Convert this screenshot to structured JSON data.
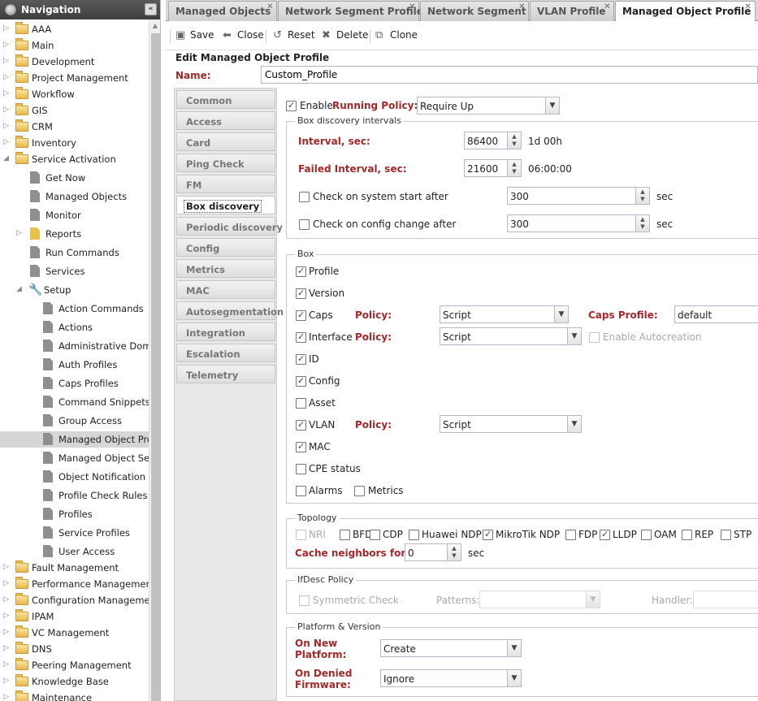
{
  "nav": {
    "title": "Navigation",
    "tree": [
      {
        "label": "AAA",
        "icon": "folder-icon",
        "expanded": false
      },
      {
        "label": "Main",
        "icon": "folder-icon",
        "expanded": false
      },
      {
        "label": "Development",
        "icon": "folder-icon",
        "expanded": false
      },
      {
        "label": "Project Management",
        "icon": "folder-icon",
        "expanded": false
      },
      {
        "label": "Workflow",
        "icon": "folder-icon",
        "expanded": false
      },
      {
        "label": "GIS",
        "icon": "folder-icon",
        "expanded": false
      },
      {
        "label": "CRM",
        "icon": "folder-icon",
        "expanded": false
      },
      {
        "label": "Inventory",
        "icon": "folder-icon",
        "expanded": false
      },
      {
        "label": "Service Activation",
        "icon": "folder-icon",
        "expanded": true
      },
      {
        "label": "Get Now",
        "icon": "document-icon"
      },
      {
        "label": "Managed Objects",
        "icon": "document-icon"
      },
      {
        "label": "Monitor",
        "icon": "document-icon"
      },
      {
        "label": "Reports",
        "icon": "report-icon",
        "expanded": false
      },
      {
        "label": "Run Commands",
        "icon": "document-icon"
      },
      {
        "label": "Services",
        "icon": "document-icon"
      },
      {
        "label": "Setup",
        "icon": "wrench-icon",
        "expanded": true
      },
      {
        "label": "Action Commands",
        "icon": "document-icon"
      },
      {
        "label": "Actions",
        "icon": "document-icon"
      },
      {
        "label": "Administrative Domains",
        "icon": "document-icon"
      },
      {
        "label": "Auth Profiles",
        "icon": "document-icon"
      },
      {
        "label": "Caps Profiles",
        "icon": "document-icon"
      },
      {
        "label": "Command Snippets",
        "icon": "document-icon"
      },
      {
        "label": "Group Access",
        "icon": "document-icon"
      },
      {
        "label": "Managed Object Profile",
        "icon": "document-icon",
        "selected": true
      },
      {
        "label": "Managed Object Selector",
        "icon": "document-icon"
      },
      {
        "label": "Object Notification",
        "icon": "document-icon"
      },
      {
        "label": "Profile Check Rules",
        "icon": "document-icon"
      },
      {
        "label": "Profiles",
        "icon": "document-icon"
      },
      {
        "label": "Service Profiles",
        "icon": "document-icon"
      },
      {
        "label": "User Access",
        "icon": "document-icon"
      },
      {
        "label": "Fault Management",
        "icon": "folder-icon",
        "expanded": false
      },
      {
        "label": "Performance Management",
        "icon": "folder-icon",
        "expanded": false
      },
      {
        "label": "Configuration Management",
        "icon": "folder-icon",
        "expanded": false
      },
      {
        "label": "IPAM",
        "icon": "folder-icon",
        "expanded": false
      },
      {
        "label": "VC Management",
        "icon": "folder-icon",
        "expanded": false
      },
      {
        "label": "DNS",
        "icon": "folder-icon",
        "expanded": false
      },
      {
        "label": "Peering Management",
        "icon": "folder-icon",
        "expanded": false
      },
      {
        "label": "Knowledge Base",
        "icon": "folder-icon",
        "expanded": false
      },
      {
        "label": "Maintenance",
        "icon": "folder-icon",
        "expanded": false
      }
    ]
  },
  "tabs": [
    {
      "label": "Managed Objects",
      "active": false
    },
    {
      "label": "Network Segment Profile",
      "active": false
    },
    {
      "label": "Network Segment",
      "active": false
    },
    {
      "label": "VLAN Profile",
      "active": false
    },
    {
      "label": "Managed Object Profile",
      "active": true
    }
  ],
  "toolbar": {
    "save": "Save",
    "close": "Close",
    "reset": "Reset",
    "delete": "Delete",
    "clone": "Clone"
  },
  "form": {
    "title": "Edit Managed Object Profile",
    "name_label": "Name:",
    "name_value": "Custom_Profile"
  },
  "side_tabs": [
    {
      "label": "Common"
    },
    {
      "label": "Access"
    },
    {
      "label": "Card"
    },
    {
      "label": "Ping Check"
    },
    {
      "label": "FM"
    },
    {
      "label": "Box discovery",
      "active": true
    },
    {
      "label": "Periodic discovery"
    },
    {
      "label": "Config"
    },
    {
      "label": "Metrics"
    },
    {
      "label": "MAC"
    },
    {
      "label": "Autosegmentation"
    },
    {
      "label": "Integration"
    },
    {
      "label": "Escalation"
    },
    {
      "label": "Telemetry"
    }
  ],
  "box_discovery": {
    "enable_label": "Enable",
    "running_policy_label": "Running Policy:",
    "running_policy_value": "Require Up",
    "intervals": {
      "legend": "Box discovery intervals",
      "interval_label": "Interval, sec:",
      "interval_value": "86400",
      "interval_hint": "1d 00h",
      "failed_label": "Failed Interval, sec:",
      "failed_value": "21600",
      "failed_hint": "06:00:00",
      "on_start_label": "Check on system start after",
      "on_start_value": "300",
      "on_start_unit": "sec",
      "on_change_label": "Check on config change after",
      "on_change_value": "300",
      "on_change_unit": "sec"
    },
    "box": {
      "legend": "Box",
      "profile": "Profile",
      "version": "Version",
      "caps": "Caps",
      "caps_policy_label": "Policy:",
      "caps_policy_value": "Script",
      "caps_profile_label": "Caps Profile:",
      "caps_profile_value": "default",
      "interface": "Interface",
      "interface_policy_label": "Policy:",
      "interface_policy_value": "Script",
      "enable_autocreation": "Enable Autocreation",
      "id": "ID",
      "config": "Config",
      "asset": "Asset",
      "vlan": "VLAN",
      "vlan_policy_label": "Policy:",
      "vlan_policy_value": "Script",
      "mac": "MAC",
      "cpe_status": "CPE status",
      "alarms": "Alarms",
      "metrics": "Metrics"
    },
    "topology": {
      "legend": "Topology",
      "protocols": [
        {
          "label": "NRI",
          "checked": false,
          "disabled": true
        },
        {
          "label": "BFD",
          "checked": false
        },
        {
          "label": "CDP",
          "checked": false
        },
        {
          "label": "Huawei NDP",
          "checked": false
        },
        {
          "label": "MikroTik NDP",
          "checked": true
        },
        {
          "label": "FDP",
          "checked": false
        },
        {
          "label": "LLDP",
          "checked": true
        },
        {
          "label": "OAM",
          "checked": false
        },
        {
          "label": "REP",
          "checked": false
        },
        {
          "label": "STP",
          "checked": false
        }
      ],
      "cache_label": "Cache neighbors for:",
      "cache_value": "0",
      "cache_unit": "sec"
    },
    "ifdesc": {
      "legend": "IfDesc Policy",
      "symmetric": "Symmetric Check",
      "patterns_label": "Patterns:",
      "handler_label": "Handler:"
    },
    "platform": {
      "legend": "Platform & Version",
      "new_platform_l1": "On New",
      "new_platform_l2": "Platform:",
      "new_platform_value": "Create",
      "denied_l1": "On Denied",
      "denied_l2": "Firmware:",
      "denied_value": "Ignore"
    }
  }
}
